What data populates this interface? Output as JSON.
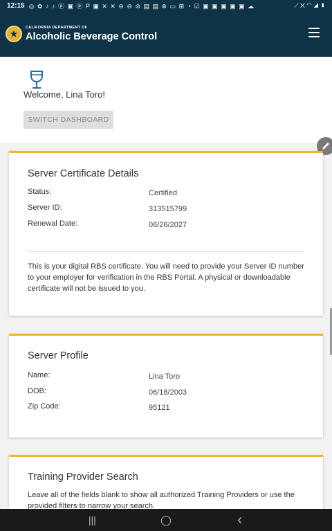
{
  "status_bar": {
    "time": "12:15",
    "notifications": "◎ ✿ ♪ ♪ ⓟ ▣ ⓟ P ▣ ✕ ✕ ⊖ ⊖ ⊘ ▤ ▤ ⊗ ▭ ⊞ ◔ ☑ ▣ ▣ ▣ ▣ ▣ ☁",
    "right": "⟋ ✕ ◠ ◢ ▮"
  },
  "header": {
    "dept_label": "CALIFORNIA DEPARTMENT OF",
    "title": "Alcoholic Beverage Control"
  },
  "welcome": {
    "greeting": "Welcome, Lina Toro!",
    "switch_button": "SWITCH DASHBOARD"
  },
  "certificate": {
    "title": "Server Certificate Details",
    "rows": [
      {
        "label": "Status:",
        "value": "Certified"
      },
      {
        "label": "Server ID:",
        "value": "313515799"
      },
      {
        "label": "Renewal Date:",
        "value": "06/26/2027"
      }
    ],
    "note": "This is your digital RBS certificate. You will need to provide your Server ID number to your employer for verification in the RBS Portal. A physical or downloadable certificate will not be issued to you."
  },
  "profile": {
    "title": "Server Profile",
    "rows": [
      {
        "label": "Name:",
        "value": "Lina Toro"
      },
      {
        "label": "DOB:",
        "value": "06/18/2003"
      },
      {
        "label": "Zip Code:",
        "value": "95121"
      }
    ]
  },
  "training": {
    "title": "Training Provider Search",
    "description": "Leave all of the fields blank to show all authorized Training Providers or use the provided filters to narrow your search."
  },
  "nav": {
    "recents": "|||",
    "home": "◯",
    "back": "‹"
  },
  "colors": {
    "header_bg": "#0e3347",
    "card_accent": "#f2b62c",
    "icon_blue": "#1f6f9f"
  }
}
